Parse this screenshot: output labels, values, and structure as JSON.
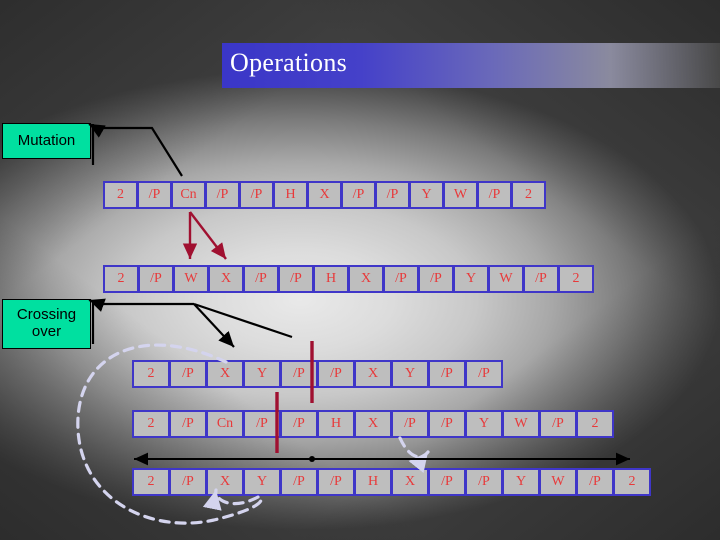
{
  "slide": {
    "title": "Operations",
    "background_colors": {
      "center": "#e9e9e9",
      "corner": "#3f3f3f",
      "title_bar_start": "#3A36C8"
    }
  },
  "callouts": [
    {
      "id": "mutation",
      "label": "Mutation",
      "fill": "#00E0A0",
      "border": "#000000"
    },
    {
      "id": "crossing_over",
      "label": "Crossing\nover",
      "line1": "Crossing",
      "line2": "over",
      "fill": "#00E0A0",
      "border": "#000000"
    }
  ],
  "chromosome_style": {
    "cell_fill": "#BEBEBE",
    "cell_border": "#3F36C8",
    "gene_text": "#E8393A"
  },
  "rows": [
    {
      "id": "row-1",
      "name": "parent-before-mutation",
      "genes": [
        "2",
        "/P",
        "Cn",
        "/P",
        "/P",
        "H",
        "X",
        "/P",
        "/P",
        "Y",
        "W",
        "/P",
        "2"
      ]
    },
    {
      "id": "row-2",
      "name": "offspring-after-mutation",
      "genes": [
        "2",
        "/P",
        "W",
        "X",
        "/P",
        "/P",
        "H",
        "X",
        "/P",
        "/P",
        "Y",
        "W",
        "/P",
        "2"
      ]
    },
    {
      "id": "row-3",
      "name": "crossover-parent-a",
      "genes": [
        "2",
        "/P",
        "X",
        "Y",
        "/P",
        "/P",
        "X",
        "Y",
        "/P",
        "/P"
      ]
    },
    {
      "id": "row-4",
      "name": "crossover-parent-b",
      "genes": [
        "2",
        "/P",
        "Cn",
        "/P",
        "/P",
        "H",
        "X",
        "/P",
        "/P",
        "Y",
        "W",
        "/P",
        "2"
      ]
    },
    {
      "id": "row-5",
      "name": "crossover-offspring",
      "genes": [
        "2",
        "/P",
        "X",
        "Y",
        "/P",
        "/P",
        "H",
        "X",
        "/P",
        "/P",
        "Y",
        "W",
        "/P",
        "2"
      ]
    }
  ],
  "annotations": {
    "mutation_arrow_color": "#000000",
    "mutation_gene_arrow_color": "#A01030",
    "crossover_marker_color": "#A01030",
    "crossover_dashed_color": "#D4D4EE",
    "span_arrow_color": "#000000"
  }
}
